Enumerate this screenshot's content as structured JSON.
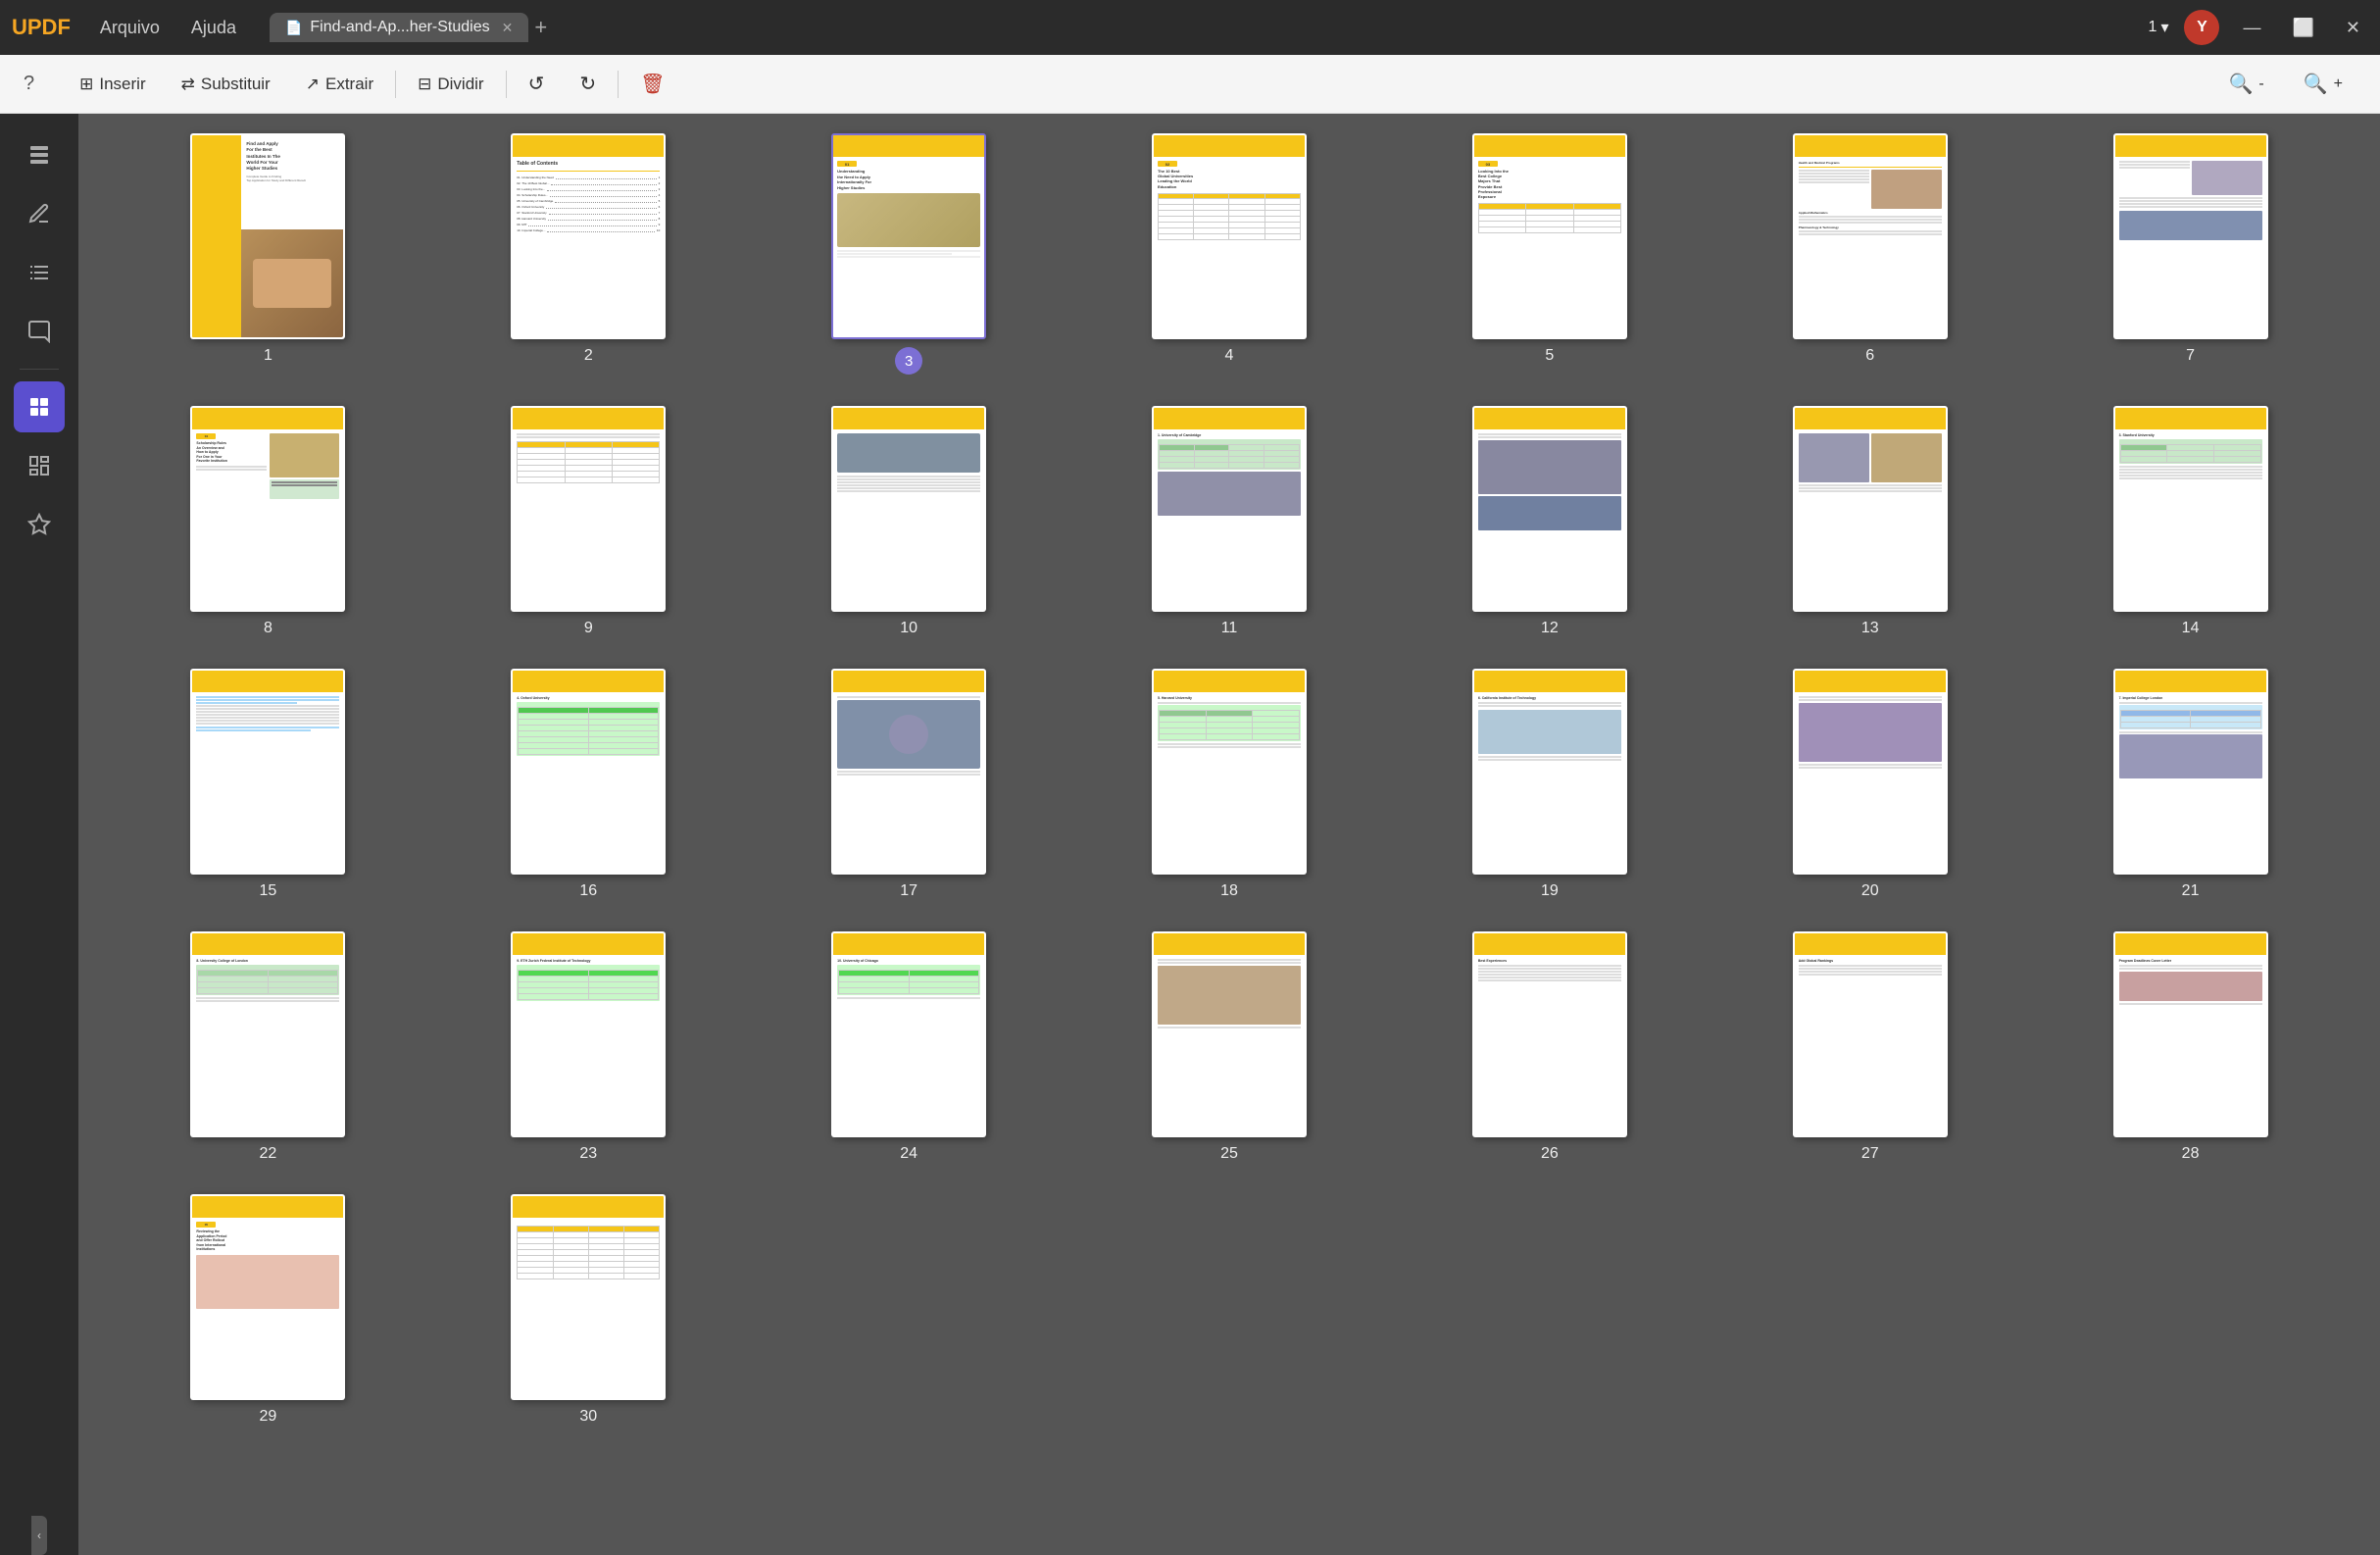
{
  "titleBar": {
    "logo": "UPDF",
    "menu": [
      "Arquivo",
      "Ajuda"
    ],
    "tab": {
      "label": "Find-and-Ap...her-Studies",
      "icon": "📄"
    },
    "addTab": "+",
    "pageNav": "1",
    "pageNavChevron": "▾",
    "userInitial": "Y",
    "winBtns": [
      "—",
      "⬜",
      "✕"
    ]
  },
  "toolbar": {
    "help": "?",
    "buttons": [
      {
        "id": "insert",
        "icon": "⊞",
        "label": "Inserir"
      },
      {
        "id": "replace",
        "icon": "⇄",
        "label": "Substituir"
      },
      {
        "id": "extract",
        "icon": "↗",
        "label": "Extrair"
      },
      {
        "id": "divide",
        "icon": "⊟",
        "label": "Dividir"
      },
      {
        "id": "rotate-left",
        "icon": "↺",
        "label": ""
      },
      {
        "id": "rotate-right",
        "icon": "↻",
        "label": ""
      },
      {
        "id": "delete",
        "icon": "🗑",
        "label": ""
      }
    ],
    "rightButtons": [
      {
        "id": "zoom-out",
        "icon": "🔍-",
        "label": ""
      },
      {
        "id": "zoom-in",
        "icon": "🔍+",
        "label": ""
      }
    ]
  },
  "sidebar": {
    "icons": [
      {
        "id": "pages",
        "icon": "☰",
        "label": "Pages",
        "active": false
      },
      {
        "id": "edit",
        "icon": "✏",
        "label": "Edit",
        "active": false
      },
      {
        "id": "list",
        "icon": "≡",
        "label": "List",
        "active": false
      },
      {
        "id": "annotate",
        "icon": "🖊",
        "label": "Annotate",
        "active": false
      },
      {
        "id": "thumbnail",
        "icon": "⊞",
        "label": "Thumbnail",
        "active": true
      },
      {
        "id": "organize",
        "icon": "📋",
        "label": "Organize",
        "active": false
      },
      {
        "id": "sticker",
        "icon": "🏷",
        "label": "Sticker",
        "active": false
      }
    ]
  },
  "pages": {
    "currentPage": 3,
    "totalPages": 30,
    "items": [
      {
        "num": 1,
        "type": "cover"
      },
      {
        "num": 2,
        "type": "toc"
      },
      {
        "num": 3,
        "type": "section-01",
        "selected": true
      },
      {
        "num": 4,
        "type": "universities-table"
      },
      {
        "num": 5,
        "type": "majors"
      },
      {
        "num": 6,
        "type": "text-heavy"
      },
      {
        "num": 7,
        "type": "text-photo"
      },
      {
        "num": 8,
        "type": "scholarship-rules"
      },
      {
        "num": 9,
        "type": "scholarship-table"
      },
      {
        "num": 10,
        "type": "section-photo"
      },
      {
        "num": 11,
        "type": "cambridge"
      },
      {
        "num": 12,
        "type": "oxford-photo"
      },
      {
        "num": 13,
        "type": "stanford-photo"
      },
      {
        "num": 14,
        "type": "stanford-text"
      },
      {
        "num": 15,
        "type": "highlight-text"
      },
      {
        "num": 16,
        "type": "oxford-table"
      },
      {
        "num": 17,
        "type": "aerial-photo"
      },
      {
        "num": 18,
        "type": "harvard"
      },
      {
        "num": 19,
        "type": "caltech"
      },
      {
        "num": 20,
        "type": "hands-photo"
      },
      {
        "num": 21,
        "type": "imperial"
      },
      {
        "num": 22,
        "type": "ucl"
      },
      {
        "num": 23,
        "type": "eth-zurich"
      },
      {
        "num": 24,
        "type": "chicago"
      },
      {
        "num": 25,
        "type": "tips-photo"
      },
      {
        "num": 26,
        "type": "best-experiences"
      },
      {
        "num": 27,
        "type": "add-global"
      },
      {
        "num": 28,
        "type": "program-deadlines"
      },
      {
        "num": 29,
        "type": "reviewing"
      },
      {
        "num": 30,
        "type": "final-table"
      }
    ]
  }
}
